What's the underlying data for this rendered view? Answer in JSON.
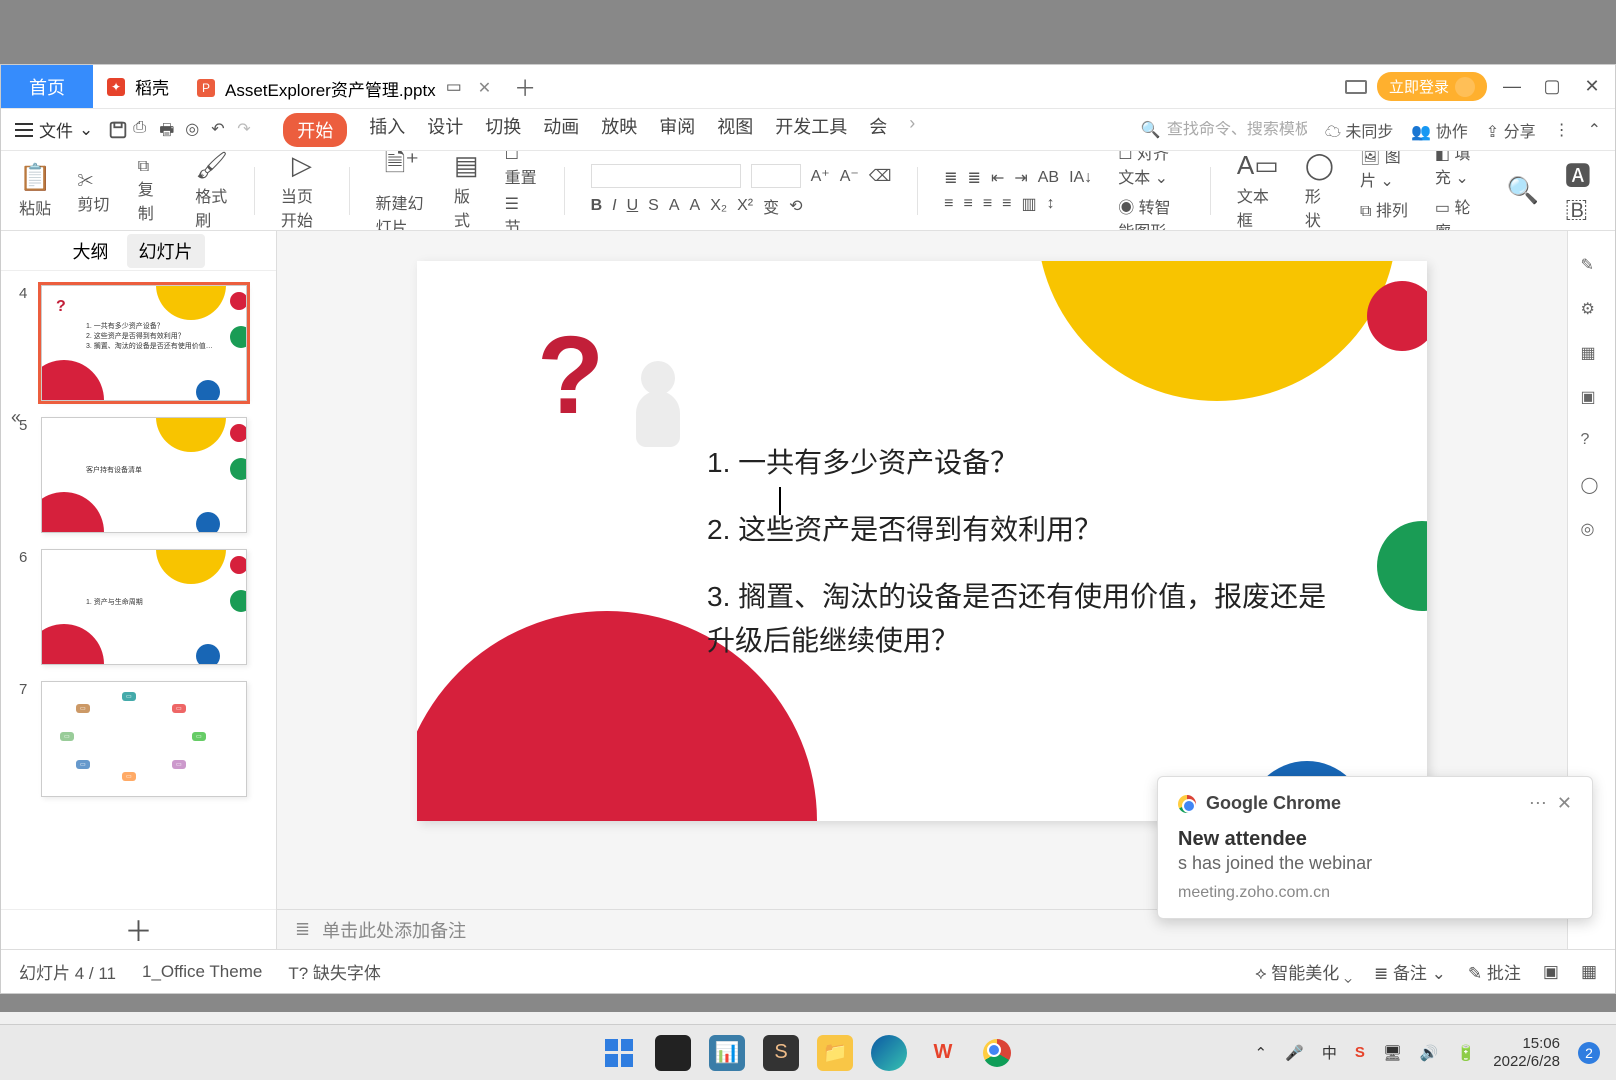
{
  "titlebar": {
    "home": "首页",
    "docke": "稻壳",
    "filename": "AssetExplorer资产管理.pptx",
    "login": "立即登录"
  },
  "menubar": {
    "file": "文件",
    "tabs": [
      "开始",
      "插入",
      "设计",
      "切换",
      "动画",
      "放映",
      "审阅",
      "视图",
      "开发工具",
      "会"
    ],
    "search_placeholder": "查找命令、搜索模板",
    "unsynced": "未同步",
    "collab": "协作",
    "share": "分享"
  },
  "ribbon": {
    "cut": "剪切",
    "copy": "复制",
    "paste": "粘贴",
    "format_painter": "格式刷",
    "from_current": "当页开始",
    "new_slide": "新建幻灯片",
    "layout": "版式",
    "sections": "节",
    "reset": "重置",
    "align_text": "对齐文本",
    "smart_shape": "转智能图形",
    "textbox": "文本框",
    "shapes": "形状",
    "arrange": "排列",
    "outline": "轮廓",
    "pictures": "图片",
    "fill": "填充"
  },
  "leftpanel": {
    "outline_tab": "大纲",
    "slides_tab": "幻灯片",
    "thumbs": [
      {
        "n": "4",
        "sel": true
      },
      {
        "n": "5",
        "sel": false,
        "caption": "客户持有设备清单"
      },
      {
        "n": "6",
        "sel": false,
        "caption": "1. 资产与生命周期"
      },
      {
        "n": "7",
        "sel": false
      }
    ]
  },
  "slide": {
    "q1": "1. 一共有多少资产设备？",
    "q2": "2. 这些资产是否得到有效利用？",
    "q3": "3. 搁置、淘汰的设备是否还有使用价值，报废还是升级后能继续使用？"
  },
  "notes_placeholder": "单击此处添加备注",
  "statusbar": {
    "slide_pos": "幻灯片 4 / 11",
    "theme": "1_Office Theme",
    "missing_font": "缺失字体",
    "beautify": "智能美化",
    "notes": "备注",
    "comments": "批注"
  },
  "toast": {
    "app": "Google Chrome",
    "title": "New attendee",
    "body": "s has joined the webinar",
    "source": "meeting.zoho.com.cn"
  },
  "taskbar": {
    "time": "15:06",
    "date": "2022/6/28"
  },
  "colors": {
    "accent": "#ec5e3e",
    "red": "#d6203c",
    "yellow": "#f8c400",
    "green": "#1a9c55",
    "blue": "#1866b5"
  },
  "chart_data": null
}
